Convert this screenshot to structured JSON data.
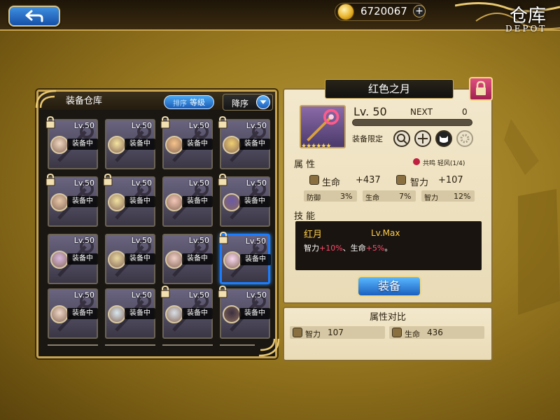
{
  "topbar": {
    "coins": "6720067",
    "coin_plus": "+",
    "title": "仓库",
    "subtitle": "DEPOT"
  },
  "left_panel": {
    "title": "装备仓库",
    "sort_prefix": "排序",
    "sort_value": "等级",
    "order_label": "降序"
  },
  "grid": [
    {
      "lv": "Lv.50",
      "status": "装备中",
      "locked": true
    },
    {
      "lv": "Lv.50",
      "status": "装备中",
      "locked": false
    },
    {
      "lv": "Lv.50",
      "status": "装备中",
      "locked": true
    },
    {
      "lv": "Lv.50",
      "status": "装备中",
      "locked": true
    },
    {
      "lv": "Lv.50",
      "status": "装备中",
      "locked": true
    },
    {
      "lv": "Lv.50",
      "status": "装备中",
      "locked": true
    },
    {
      "lv": "Lv.50",
      "status": "装备中",
      "locked": false
    },
    {
      "lv": "Lv.50",
      "status": "装备中",
      "locked": true
    },
    {
      "lv": "Lv.50",
      "status": "装备中",
      "locked": false
    },
    {
      "lv": "Lv.50",
      "status": "装备中",
      "locked": false
    },
    {
      "lv": "Lv.50",
      "status": "装备中",
      "locked": false
    },
    {
      "lv": "Lv.50",
      "status": "装备中",
      "locked": true
    },
    {
      "lv": "Lv.50",
      "status": "装备中",
      "locked": false
    },
    {
      "lv": "Lv.50",
      "status": "装备中",
      "locked": false
    },
    {
      "lv": "Lv.50",
      "status": "装备中",
      "locked": true
    },
    {
      "lv": "Lv.50",
      "status": "装备中",
      "locked": true
    }
  ],
  "selected_index": 11,
  "detail": {
    "name": "红色之月",
    "level": "Lv. 50",
    "next_label": "NEXT",
    "next_value": "0",
    "restrict_label": "装备限定",
    "attr_header": "属 性",
    "share_label": "共鸣 轻风(1/4)",
    "hp_label": "生命",
    "hp_value": "+437",
    "int_label": "智力",
    "int_value": "+107",
    "sub_stats": [
      {
        "k": "防御",
        "v": "3%"
      },
      {
        "k": "生命",
        "v": "7%"
      },
      {
        "k": "智力",
        "v": "12%"
      }
    ],
    "skill_header": "技 能",
    "skill_name": "红月",
    "skill_lv": "Lv.Max",
    "skill_desc_1": "智力",
    "skill_desc_2": "+10%",
    "skill_desc_3": "、生命",
    "skill_desc_4": "+5%",
    "skill_desc_5": "。",
    "equip_button": "装备",
    "stars": "★★★★★★"
  },
  "compare": {
    "title": "属性对比",
    "int_label": "智力",
    "int_value": "107",
    "hp_label": "生命",
    "hp_value": "436"
  },
  "colors": {
    "accent_blue": "#1a7cff",
    "gold": "#c9a44e",
    "red_highlight": "#ff4a6a",
    "skill_yellow": "#ffcf4a"
  }
}
